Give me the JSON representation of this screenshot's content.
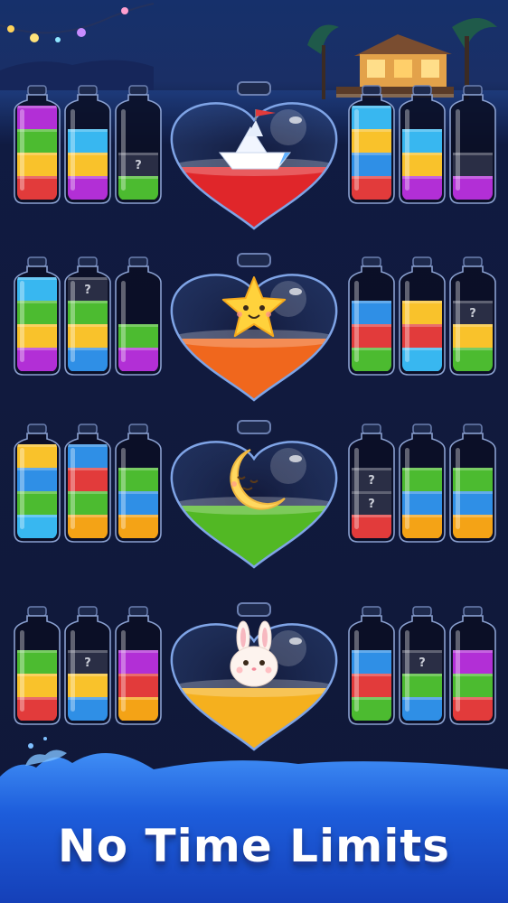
{
  "banner": {
    "text": "No Time Limits"
  },
  "colors": {
    "red": "#e23b3b",
    "yellow": "#f9c22b",
    "green": "#4cbb30",
    "purple": "#b22fd6",
    "blue": "#2f8fe6",
    "cyan": "#38b7f0",
    "orange": "#f4a316",
    "dark": "#2a2e45"
  },
  "rows": [
    {
      "center": {
        "icon": "paper-boat-icon",
        "liquid": "#e0262a"
      },
      "left": [
        [
          "red",
          "yellow",
          "green",
          "purple"
        ],
        [
          "purple",
          "yellow",
          "cyan",
          "empty"
        ],
        [
          "green",
          "dark",
          "empty",
          "empty"
        ]
      ],
      "right": [
        [
          "red",
          "blue",
          "yellow",
          "cyan"
        ],
        [
          "purple",
          "yellow",
          "cyan",
          "empty"
        ],
        [
          "purple",
          "dark",
          "empty",
          "empty"
        ]
      ],
      "unknown_left": [
        [],
        [],
        [
          1
        ]
      ],
      "unknown_right": [
        [],
        [],
        []
      ]
    },
    {
      "center": {
        "icon": "star-face-icon",
        "liquid": "#f0671d"
      },
      "left": [
        [
          "purple",
          "yellow",
          "green",
          "cyan"
        ],
        [
          "blue",
          "yellow",
          "green",
          "dark"
        ],
        [
          "purple",
          "green",
          "empty",
          "empty"
        ]
      ],
      "right": [
        [
          "green",
          "red",
          "blue",
          "empty"
        ],
        [
          "cyan",
          "red",
          "yellow",
          "empty"
        ],
        [
          "green",
          "yellow",
          "dark",
          "empty"
        ]
      ],
      "unknown_left": [
        [],
        [
          3
        ],
        []
      ],
      "unknown_right": [
        [],
        [],
        [
          2
        ]
      ]
    },
    {
      "center": {
        "icon": "moon-face-icon",
        "liquid": "#52b824"
      },
      "left": [
        [
          "cyan",
          "green",
          "blue",
          "yellow"
        ],
        [
          "orange",
          "green",
          "red",
          "blue"
        ],
        [
          "orange",
          "blue",
          "green",
          "empty"
        ]
      ],
      "right": [
        [
          "red",
          "dark",
          "dark",
          "empty"
        ],
        [
          "orange",
          "blue",
          "green",
          "empty"
        ],
        [
          "orange",
          "blue",
          "green",
          "empty"
        ]
      ],
      "unknown_left": [
        [],
        [],
        []
      ],
      "unknown_right": [
        [
          1,
          2
        ],
        [],
        []
      ]
    },
    {
      "center": {
        "icon": "bunny-face-icon",
        "liquid": "#f5b01e"
      },
      "left": [
        [
          "red",
          "yellow",
          "green",
          "empty"
        ],
        [
          "blue",
          "yellow",
          "dark",
          "empty"
        ],
        [
          "orange",
          "red",
          "purple",
          "empty"
        ]
      ],
      "right": [
        [
          "green",
          "red",
          "blue",
          "empty"
        ],
        [
          "blue",
          "green",
          "dark",
          "empty"
        ],
        [
          "red",
          "green",
          "purple",
          "empty"
        ]
      ],
      "unknown_left": [
        [],
        [
          2
        ],
        []
      ],
      "unknown_right": [
        [],
        [
          2
        ],
        []
      ]
    }
  ]
}
